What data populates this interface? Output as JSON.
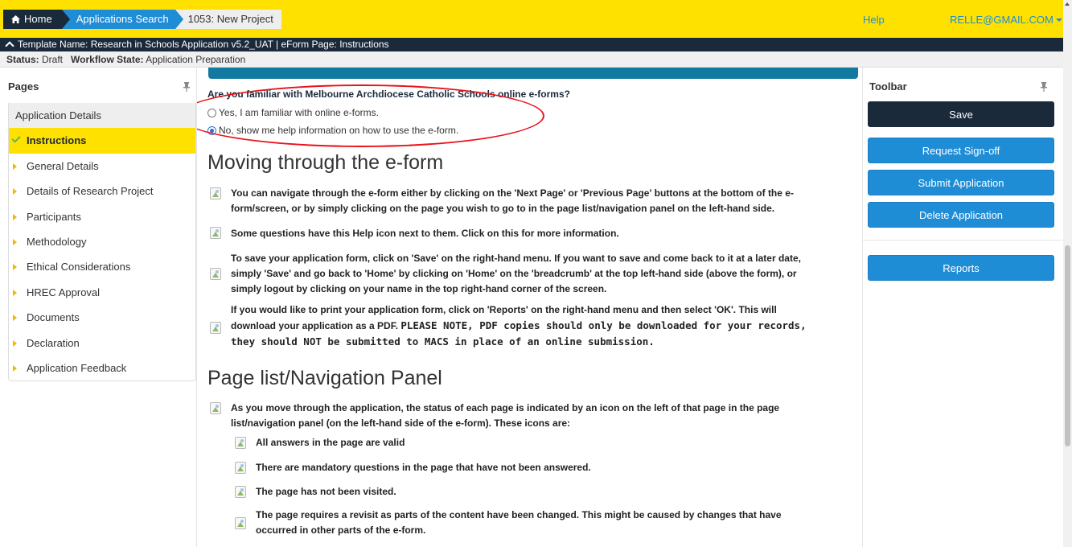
{
  "nav": {
    "home": "Home",
    "search": "Applications Search",
    "current": "1053: New Project",
    "help": "Help",
    "user": "RELLE@GMAIL.COM"
  },
  "template_bar": "Template Name: Research in Schools Application v5.2_UAT | eForm Page: Instructions",
  "status": {
    "status_label": "Status:",
    "status_value": "Draft",
    "workflow_label": "Workflow State:",
    "workflow_value": "Application Preparation"
  },
  "pages": {
    "title": "Pages",
    "items": [
      "Application Details",
      "Instructions",
      "General Details",
      "Details of Research Project",
      "Participants",
      "Methodology",
      "Ethical Considerations",
      "HREC Approval",
      "Documents",
      "Declaration",
      "Application Feedback"
    ]
  },
  "content": {
    "question": "Are you familiar with Melbourne Archdiocese Catholic Schools online e-forms?",
    "option_yes": "Yes, I am familiar with online e-forms.",
    "option_no": "No, show me help information on how to use the e-form.",
    "selected": "no",
    "h_moving": "Moving through the e-form",
    "p1_l1": "You can navigate through the e-form either by clicking on the 'Next Page' or 'Previous Page' buttons at the bottom of the e-",
    "p1_l2": "form/screen, or by simply clicking on the page you wish to go to in the page list/navigation panel on the left-hand side.",
    "p2": "Some questions have this Help icon next to them. Click on this for more information.",
    "p3_l1": "To save your application form, click on 'Save' on the right-hand menu. If you want to save and come back to it at a later date,",
    "p3_l2": "simply 'Save' and go back to 'Home' by clicking on 'Home' on the 'breadcrumb' at the top left-hand side (above the form), or",
    "p3_l3": "simply logout by clicking on your name in the top right-hand corner of the screen.",
    "p4_l1": "If you would like to print your application form, click on 'Reports' on the right-hand menu and then select 'OK'. This will",
    "p4_l2a": "download your application as a PDF.",
    "p4_l2b": "PLEASE NOTE, PDF copies should only be downloaded for your records,",
    "p4_l3": "they should NOT be submitted to MACS in place of an online submission.",
    "h_panel": "Page list/Navigation Panel",
    "p5_l1": "As you move through the application, the status of each page is indicated by an icon on the left of that page in the page",
    "p5_l2": "list/navigation panel (on the left-hand side of the e-form). These icons are:",
    "i1": "All answers in the page are valid",
    "i2": "There are mandatory questions in the page that have not been answered.",
    "i3": "The page has not been visited.",
    "i4_l1": "The page requires a revisit as parts of the content have been changed. This might be caused by changes that have",
    "i4_l2": "occurred in other parts of the e-form."
  },
  "toolbar": {
    "title": "Toolbar",
    "save": "Save",
    "request": "Request Sign-off",
    "submit": "Submit Application",
    "delete": "Delete Application",
    "reports": "Reports"
  },
  "colors": {
    "accent_yellow": "#FFE100",
    "navy": "#1b2a3b",
    "blue": "#1f8dd6",
    "annotation_red": "#e8141b"
  }
}
